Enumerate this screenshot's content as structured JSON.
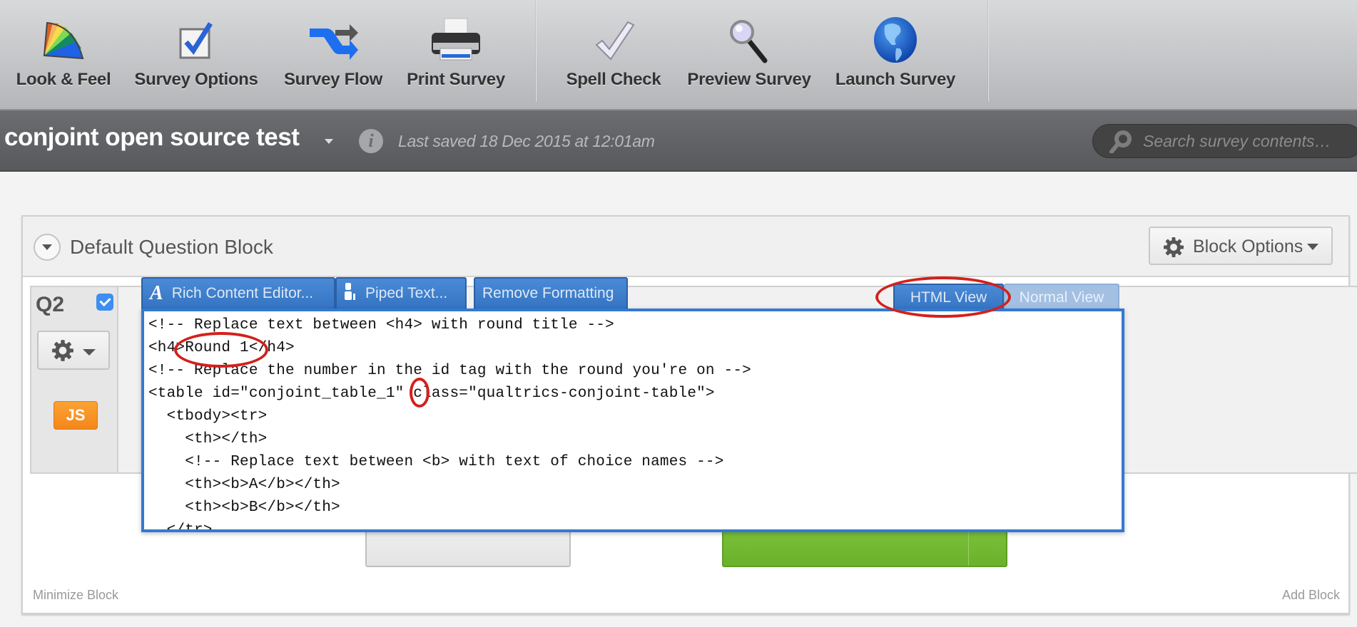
{
  "toolbar": {
    "items": [
      {
        "id": "look-feel",
        "label": "Look & Feel",
        "icon": "color-fan-icon"
      },
      {
        "id": "survey-options",
        "label": "Survey Options",
        "icon": "checkbox-icon"
      },
      {
        "id": "survey-flow",
        "label": "Survey Flow",
        "icon": "flow-arrows-icon"
      },
      {
        "id": "print-survey",
        "label": "Print Survey",
        "icon": "printer-icon"
      },
      {
        "id": "spell-check",
        "label": "Spell Check",
        "icon": "checkmark-icon"
      },
      {
        "id": "preview-survey",
        "label": "Preview Survey",
        "icon": "magnifier-icon"
      },
      {
        "id": "launch-survey",
        "label": "Launch Survey",
        "icon": "globe-icon"
      }
    ]
  },
  "titlebar": {
    "survey_title": "conjoint open source test",
    "last_saved": "Last saved 18 Dec 2015 at 12:01am",
    "search_placeholder": "Search survey contents…"
  },
  "block": {
    "title": "Default Question Block",
    "options_label": "Block Options",
    "minimize_label": "Minimize Block",
    "add_block_label": "Add Block",
    "question": {
      "number": "Q2",
      "selected": true,
      "js_badge": "JS"
    }
  },
  "editor": {
    "buttons": [
      {
        "label": "Rich Content Editor...",
        "icon": "A"
      },
      {
        "label": "Piped Text...",
        "icon": "piped-text"
      },
      {
        "label": "Remove Formatting"
      }
    ],
    "view_tabs": {
      "html": "HTML View",
      "normal": "Normal View",
      "active": "html"
    },
    "code_lines": [
      "<!-- Replace text between <h4> with round title -->",
      "<h4>Round 1</h4>",
      "<!-- Replace the number in the id tag with the round you're on -->",
      "<table id=\"conjoint_table_1\" class=\"qualtrics-conjoint-table\">",
      "  <tbody><tr>",
      "    <th></th>",
      "    <!-- Replace text between <b> with text of choice names -->",
      "    <th><b>A</b></th>",
      "    <th><b>B</b></th>",
      "  </tr>"
    ]
  },
  "colors": {
    "accent_blue": "#3479d2",
    "annotation_red": "#d3201c",
    "js_orange": "#f5861c",
    "green": "#6ab22c"
  }
}
